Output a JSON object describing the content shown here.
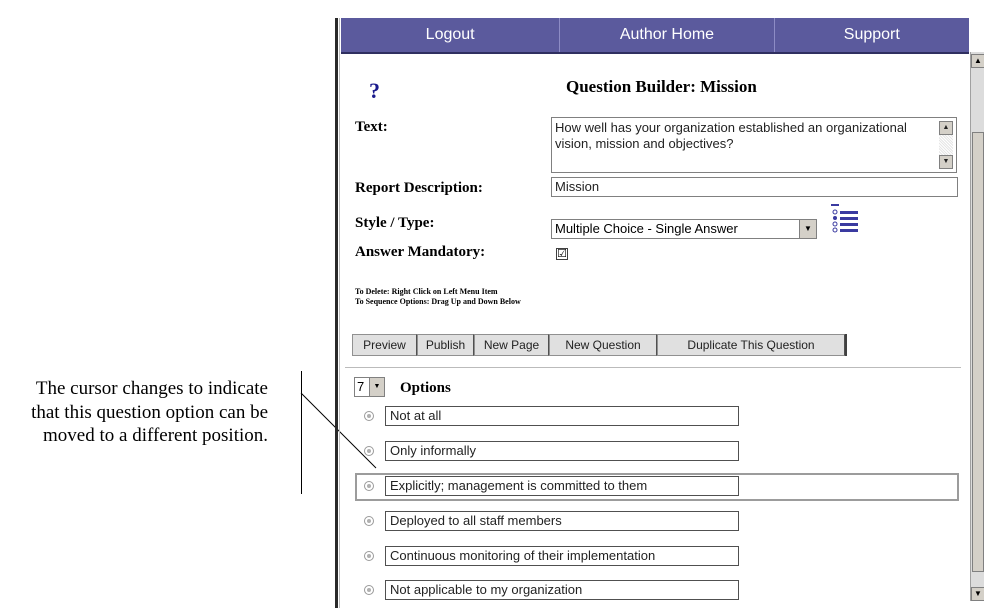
{
  "annotation": {
    "text": "The cursor changes to indicate that this question option can be moved to a different position."
  },
  "nav": {
    "items": [
      "Logout",
      "Author Home",
      "Support"
    ]
  },
  "builder": {
    "title": "Question Builder: Mission",
    "help_icon": "question-mark-icon",
    "text_label": "Text:",
    "text_value": "How well has your organization established an organizational vision, mission and objectives?",
    "report_label": "Report Description:",
    "report_value": "Mission",
    "style_label": "Style / Type:",
    "style_value": "Multiple Choice - Single Answer",
    "mandatory_label": "Answer Mandatory:",
    "mandatory_checked": true,
    "check_mark": "☑",
    "hint_delete": "To Delete: Right Click on Left Menu Item",
    "hint_sequence": "To Sequence Options: Drag Up and Down Below"
  },
  "toolbar": {
    "preview": "Preview",
    "publish": "Publish",
    "new_page": "New Page",
    "new_question": "New Question",
    "duplicate": "Duplicate This Question"
  },
  "options": {
    "count": "7",
    "label": "Options",
    "items": [
      "Not at all",
      "Only informally",
      "Explicitly; management is committed to them",
      "Deployed to all staff members",
      "Continuous monitoring of their implementation",
      "Not applicable to my organization"
    ],
    "highlighted_index": 2
  },
  "colors": {
    "nav_bg": "#5b5a9d",
    "accent": "#1a1a8c"
  }
}
